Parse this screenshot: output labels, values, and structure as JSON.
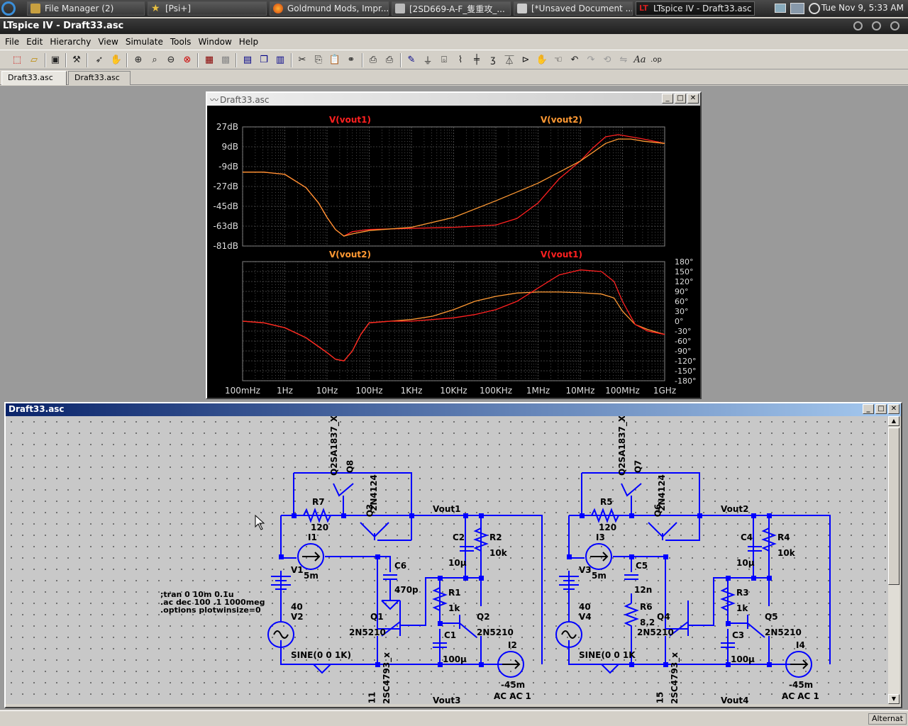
{
  "taskbar": {
    "items": [
      {
        "label": "File Manager (2)",
        "icon": "folder-icon"
      },
      {
        "label": "[Psi+]",
        "icon": "star-icon"
      },
      {
        "label": "Goldmund Mods, Impr...",
        "icon": "firefox-icon"
      },
      {
        "label": "[2SD669-A-F_隻重攻_...",
        "icon": "document-icon"
      },
      {
        "label": "[*Unsaved Document ...",
        "icon": "editor-icon"
      },
      {
        "label": "LTspice IV - Draft33.asc",
        "icon": "ltspice-icon"
      }
    ],
    "clock": "Tue Nov  9,  5:33 AM"
  },
  "app": {
    "title": "LTspice IV - Draft33.asc"
  },
  "menu": [
    "File",
    "Edit",
    "Hierarchy",
    "View",
    "Simulate",
    "Tools",
    "Window",
    "Help"
  ],
  "tabs": [
    "Draft33.asc",
    "Draft33.asc"
  ],
  "plot_window": {
    "title": "Draft33.asc"
  },
  "schematic_window": {
    "title": "Draft33.asc"
  },
  "status": "Alternat",
  "colors": {
    "trace_vout1": "#ff2020",
    "trace_vout2": "#ff9933",
    "wire": "#0000ff",
    "grid_bg": "#000000"
  },
  "schematic": {
    "left": {
      "q_top": "Q2SA1837_X",
      "q_top_ref": "Q8",
      "q3": "Q3",
      "q3_model": "2N4124",
      "r7": "R7",
      "r7_val": "120",
      "i1": "I1",
      "i1_val": "5m",
      "v1": "V1",
      "v1_val": "40",
      "v2": "V2",
      "v2_val": "SINE(0 0 1K)",
      "c6": "C6",
      "c6_val": "470p",
      "c2": "C2",
      "c2_val": "10µ",
      "r2": "R2",
      "r2_val": "10k",
      "r1": "R1",
      "r1_val": "1k",
      "q1": "Q1",
      "q1_model": "2N5210",
      "q2": "Q2",
      "q2_model": "2N5210",
      "c1": "C1",
      "c1_val": "100µ",
      "i2": "I2",
      "i2_val": "-45m",
      "i2_ac": "AC AC 1",
      "vout1": "Vout1",
      "vout3": "Vout3",
      "q_bottom": "2SC4793_x",
      "q_bottom_ref": "11"
    },
    "right": {
      "q_top": "Q2SA1837_X",
      "q_top_ref": "Q7",
      "q6": "Q6",
      "q6_model": "2N4124",
      "r5": "R5",
      "r5_val": "120",
      "i3": "I3",
      "i3_val": "5m",
      "v3": "V3",
      "v3_val": "40",
      "v4": "V4",
      "v4_val": "SINE(0 0 1K",
      "c5": "C5",
      "c5_val": "12n",
      "r6": "R6",
      "r6_val": "8.2",
      "c4": "C4",
      "c4_val": "10µ",
      "r4": "R4",
      "r4_val": "10k",
      "r3": "R3",
      "r3_val": "1k",
      "q4": "Q4",
      "q4_model": "2N5210",
      "q5": "Q5",
      "q5_model": "2N5210",
      "c3": "C3",
      "c3_val": "100µ",
      "i4": "I4",
      "i4_val": "-45m",
      "i4_ac": "AC AC 1",
      "vout2": "Vout2",
      "vout4": "Vout4",
      "q_bottom": "2SC4793_x",
      "q_bottom_ref": "15"
    },
    "directives": [
      ";tran 0 10m 0.1u",
      ".ac dec 100 .1 1000meg",
      ".options plotwinsize=0"
    ]
  },
  "chart_data": [
    {
      "type": "line",
      "title": "",
      "legend": [
        "V(vout1)",
        "V(vout2)"
      ],
      "x_ticks": [
        "100mHz",
        "1Hz",
        "10Hz",
        "100Hz",
        "1KHz",
        "10KHz",
        "100KHz",
        "1MHz",
        "10MHz",
        "100MHz",
        "1GHz"
      ],
      "xlim": [
        -1,
        9
      ],
      "xscale": "log",
      "y_ticks": [
        "27dB",
        "9dB",
        "-9dB",
        "-27dB",
        "-45dB",
        "-63dB",
        "-81dB"
      ],
      "ylim": [
        -81,
        27
      ],
      "series": [
        {
          "name": "V(vout1)",
          "x": [
            -1,
            -0.5,
            0,
            0.5,
            0.8,
            1,
            1.2,
            1.4,
            1.6,
            2,
            3,
            4,
            5,
            5.5,
            6,
            6.5,
            7,
            7.3,
            7.6,
            7.9,
            8.2,
            8.5,
            9
          ],
          "y": [
            -14,
            -14,
            -16,
            -28,
            -42,
            -55,
            -66,
            -72,
            -68,
            -66,
            -65,
            -64,
            -62,
            -56,
            -42,
            -20,
            -4,
            8,
            18,
            20,
            18,
            16,
            12
          ]
        },
        {
          "name": "V(vout2)",
          "x": [
            -1,
            -0.5,
            0,
            0.5,
            0.8,
            1,
            1.2,
            1.4,
            1.6,
            2,
            3,
            4,
            5,
            5.5,
            6,
            6.5,
            7,
            7.3,
            7.6,
            7.9,
            8.2,
            8.5,
            9
          ],
          "y": [
            -14,
            -14,
            -16,
            -28,
            -42,
            -55,
            -66,
            -72,
            -70,
            -67,
            -64,
            -55,
            -40,
            -32,
            -24,
            -14,
            -4,
            4,
            12,
            16,
            16,
            14,
            12
          ]
        }
      ],
      "grid": true
    },
    {
      "type": "line",
      "title": "",
      "legend": [
        "V(vout2)",
        "V(vout1)"
      ],
      "x_ticks": [
        "100mHz",
        "1Hz",
        "10Hz",
        "100Hz",
        "1KHz",
        "10KHz",
        "100KHz",
        "1MHz",
        "10MHz",
        "100MHz",
        "1GHz"
      ],
      "xlim": [
        -1,
        9
      ],
      "xscale": "log",
      "y_ticks": [
        "180°",
        "150°",
        "120°",
        "90°",
        "60°",
        "30°",
        "0°",
        "-30°",
        "-60°",
        "-90°",
        "-120°",
        "-150°",
        "-180°"
      ],
      "ylim": [
        -180,
        180
      ],
      "series": [
        {
          "name": "V(vout2)",
          "x": [
            -1,
            -0.5,
            0,
            0.5,
            1,
            1.2,
            1.4,
            1.6,
            1.8,
            2,
            2.5,
            3,
            3.5,
            4,
            4.5,
            5,
            5.5,
            6,
            6.5,
            7,
            7.5,
            7.8,
            8,
            8.3,
            8.6,
            9
          ],
          "y": [
            0,
            -5,
            -20,
            -50,
            -95,
            -115,
            -120,
            -90,
            -40,
            -5,
            0,
            5,
            15,
            35,
            60,
            75,
            85,
            88,
            88,
            86,
            82,
            70,
            30,
            -10,
            -25,
            -40
          ]
        },
        {
          "name": "V(vout1)",
          "x": [
            -1,
            -0.5,
            0,
            0.5,
            1,
            1.2,
            1.4,
            1.6,
            1.8,
            2,
            2.5,
            3,
            3.5,
            4,
            4.5,
            5,
            5.5,
            6,
            6.5,
            7,
            7.5,
            7.8,
            8,
            8.3,
            8.6,
            9
          ],
          "y": [
            0,
            -5,
            -20,
            -50,
            -95,
            -115,
            -120,
            -90,
            -40,
            -5,
            0,
            0,
            5,
            10,
            20,
            35,
            60,
            100,
            140,
            155,
            150,
            120,
            60,
            -10,
            -30,
            -40
          ]
        }
      ],
      "grid": true
    }
  ]
}
